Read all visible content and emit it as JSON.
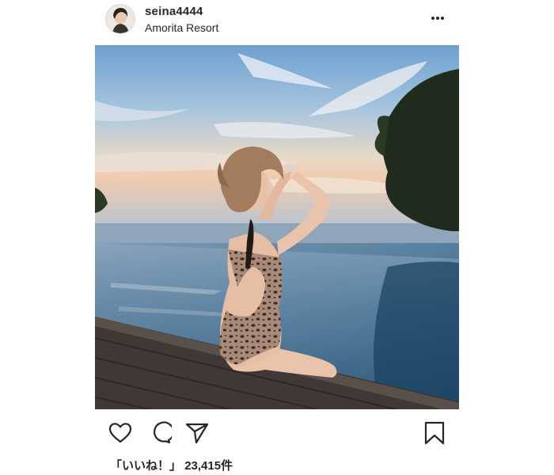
{
  "post": {
    "username": "seina4444",
    "location": "Amorita Resort",
    "likes_label": "「いいね！」",
    "likes_count": "23,415件"
  },
  "icons": {
    "more": "more-options-icon",
    "like": "heart-icon",
    "comment": "comment-icon",
    "share": "send-icon",
    "save": "bookmark-icon"
  },
  "colors": {
    "text": "#262626",
    "border": "#dbdbdb",
    "background": "#ffffff"
  }
}
